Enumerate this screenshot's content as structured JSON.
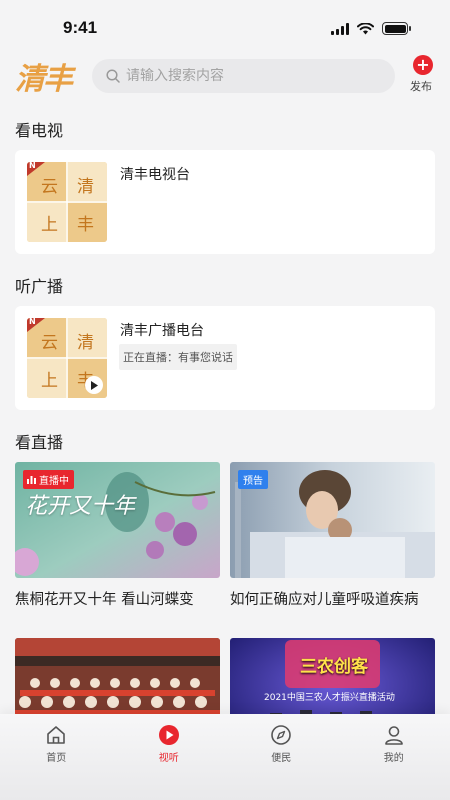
{
  "status": {
    "time": "9:41"
  },
  "header": {
    "logo": "清丰",
    "search_placeholder": "请输入搜索内容",
    "publish_label": "发布"
  },
  "tv": {
    "section_title": "看电视",
    "card_title": "清丰电视台",
    "thumb_chars": [
      "云",
      "清",
      "上",
      "丰"
    ],
    "thumb_badge": "N"
  },
  "radio": {
    "section_title": "听广播",
    "card_title": "清丰广播电台",
    "now_playing": "正在直播：有事您说话",
    "thumb_chars": [
      "云",
      "清",
      "上",
      "丰"
    ],
    "thumb_badge": "N"
  },
  "live": {
    "section_title": "看直播",
    "items": [
      {
        "badge": "直播中",
        "title": "焦桐花开又十年 看山河蝶变",
        "art_text": "花开又十年"
      },
      {
        "badge": "预告",
        "title": "如何正确应对儿童呼吸道疾病"
      },
      {
        "title": ""
      },
      {
        "title": "",
        "art_text": "三农创客",
        "art_subtitle": "2021中国三农人才振兴直播活动"
      }
    ]
  },
  "tabs": [
    {
      "label": "首页",
      "icon": "home-icon",
      "active": false
    },
    {
      "label": "视听",
      "icon": "play-circle-icon",
      "active": true
    },
    {
      "label": "便民",
      "icon": "compass-icon",
      "active": false
    },
    {
      "label": "我的",
      "icon": "user-icon",
      "active": false
    }
  ],
  "colors": {
    "accent": "#e8262e",
    "logo": "#e8a044",
    "preview_badge": "#2f80ed"
  }
}
